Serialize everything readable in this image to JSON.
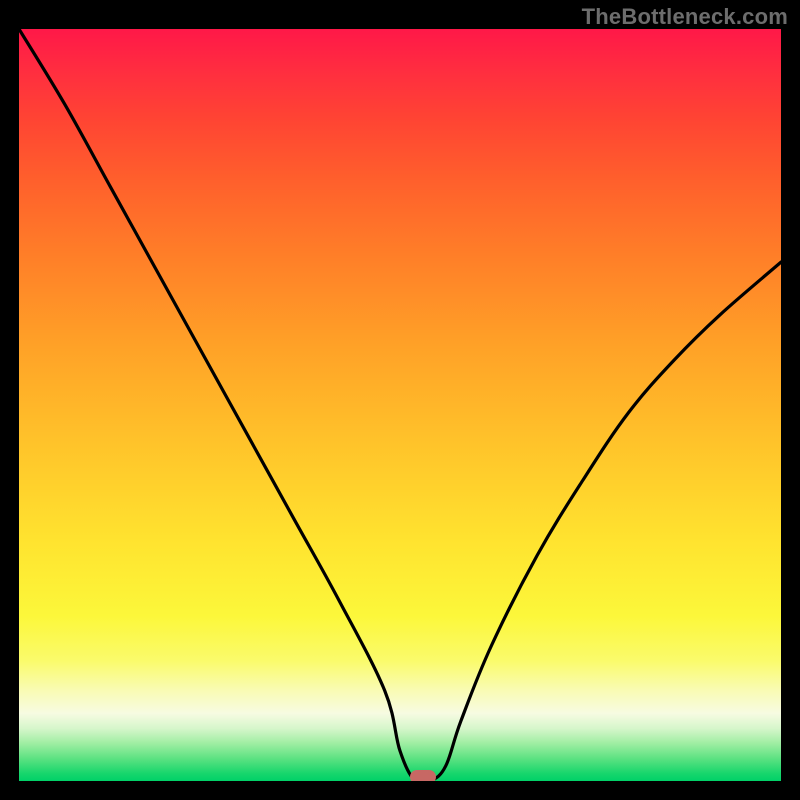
{
  "attribution": "TheBottleneck.com",
  "chart_data": {
    "type": "line",
    "title": "",
    "xlabel": "",
    "ylabel": "",
    "xlim": [
      0,
      100
    ],
    "ylim": [
      0,
      100
    ],
    "series": [
      {
        "name": "bottleneck-curve",
        "x": [
          0,
          6,
          12,
          18,
          24,
          30,
          36,
          42,
          48,
          50,
          52,
          54,
          56,
          58,
          62,
          68,
          74,
          80,
          86,
          92,
          100
        ],
        "values": [
          100,
          90,
          79,
          68,
          57,
          46,
          35,
          24,
          12,
          4,
          0,
          0,
          2,
          8,
          18,
          30,
          40,
          49,
          56,
          62,
          69
        ]
      }
    ],
    "marker": {
      "x": 53,
      "y": 0.5
    },
    "background": {
      "type": "vertical-gradient",
      "stops": [
        {
          "pos": 0,
          "color": "#ff1848"
        },
        {
          "pos": 12,
          "color": "#ff4433"
        },
        {
          "pos": 30,
          "color": "#ff7e28"
        },
        {
          "pos": 55,
          "color": "#ffc32a"
        },
        {
          "pos": 78,
          "color": "#fcf73a"
        },
        {
          "pos": 91,
          "color": "#f7fbe2"
        },
        {
          "pos": 100,
          "color": "#00d168"
        }
      ]
    }
  }
}
